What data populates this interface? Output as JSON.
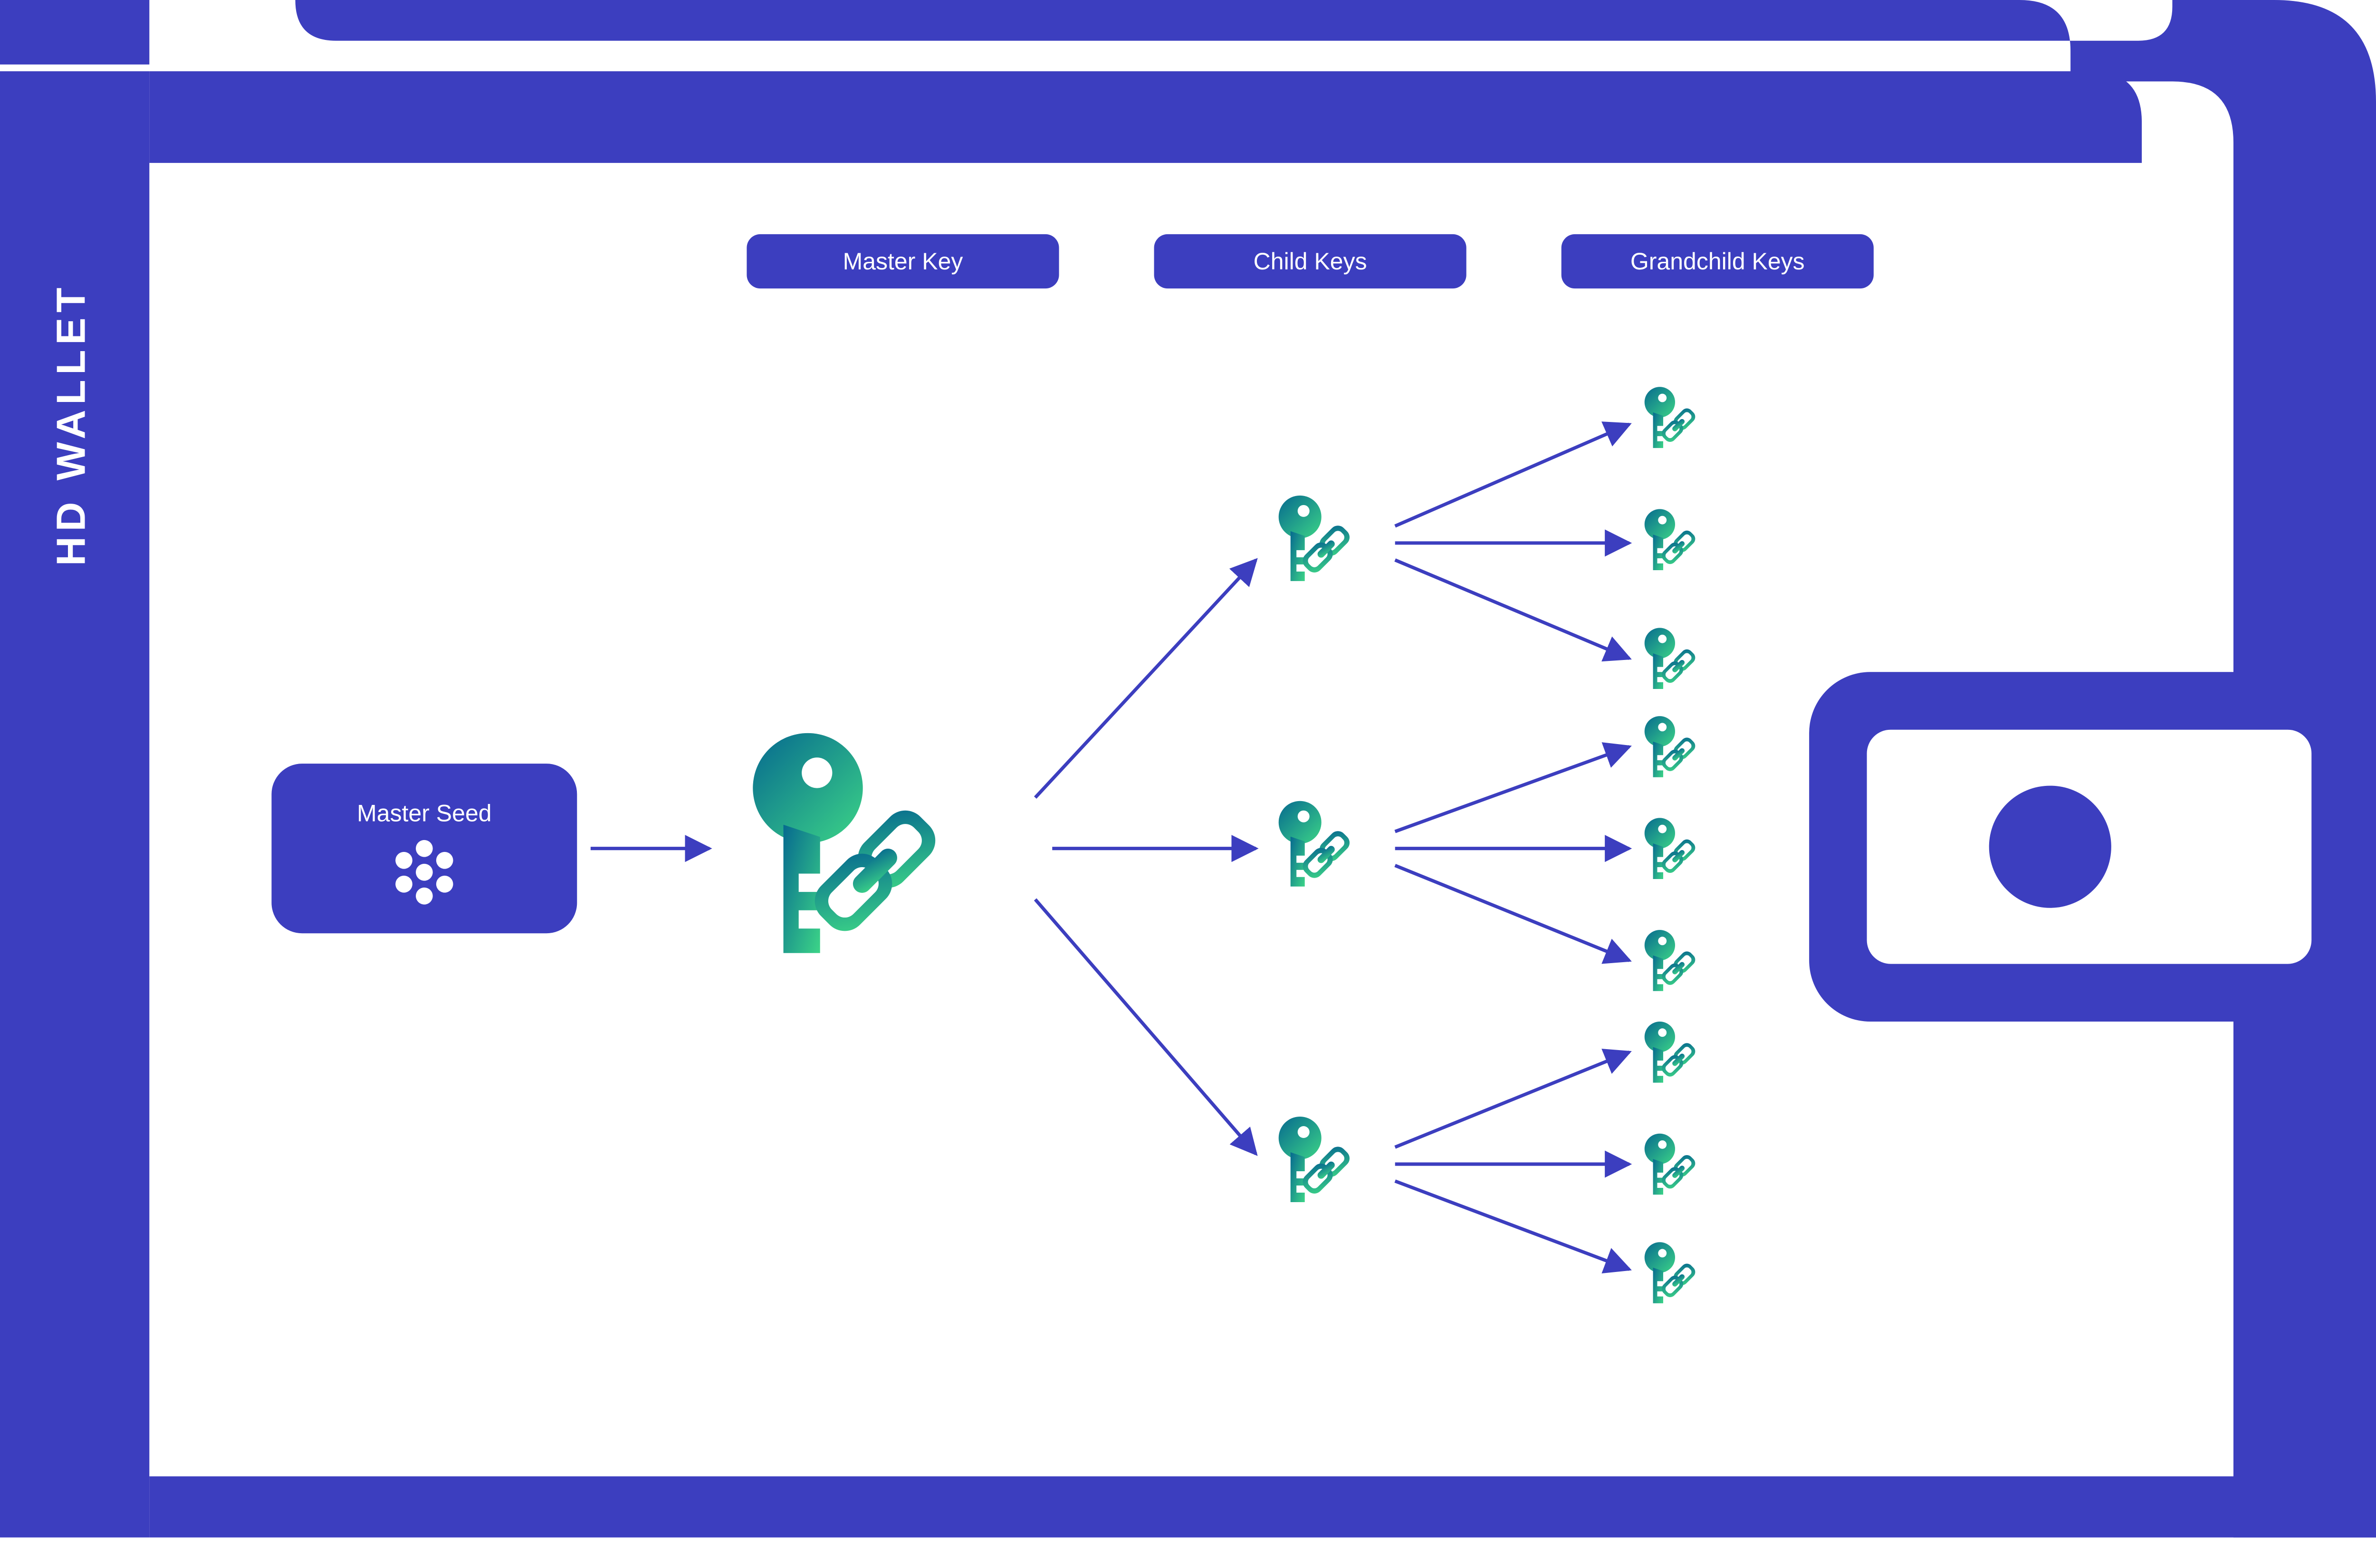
{
  "title": "HD  WALLET",
  "seed": {
    "label": "Master Seed"
  },
  "pills": {
    "master": "Master Key",
    "child": "Child Keys",
    "grandchild": "Grandchild Keys"
  },
  "icons": {
    "key": "key-icon",
    "chain": "chain-link-icon",
    "seed_dots": "seed-dots-icon",
    "wallet_button": "wallet-button-icon"
  },
  "structure": {
    "master_key": 1,
    "child_keys": 3,
    "grandchild_keys_per_child": 3
  },
  "colors": {
    "primary": "#3C3EBF",
    "gradient_from": "#06698F",
    "gradient_to": "#3CD487"
  }
}
